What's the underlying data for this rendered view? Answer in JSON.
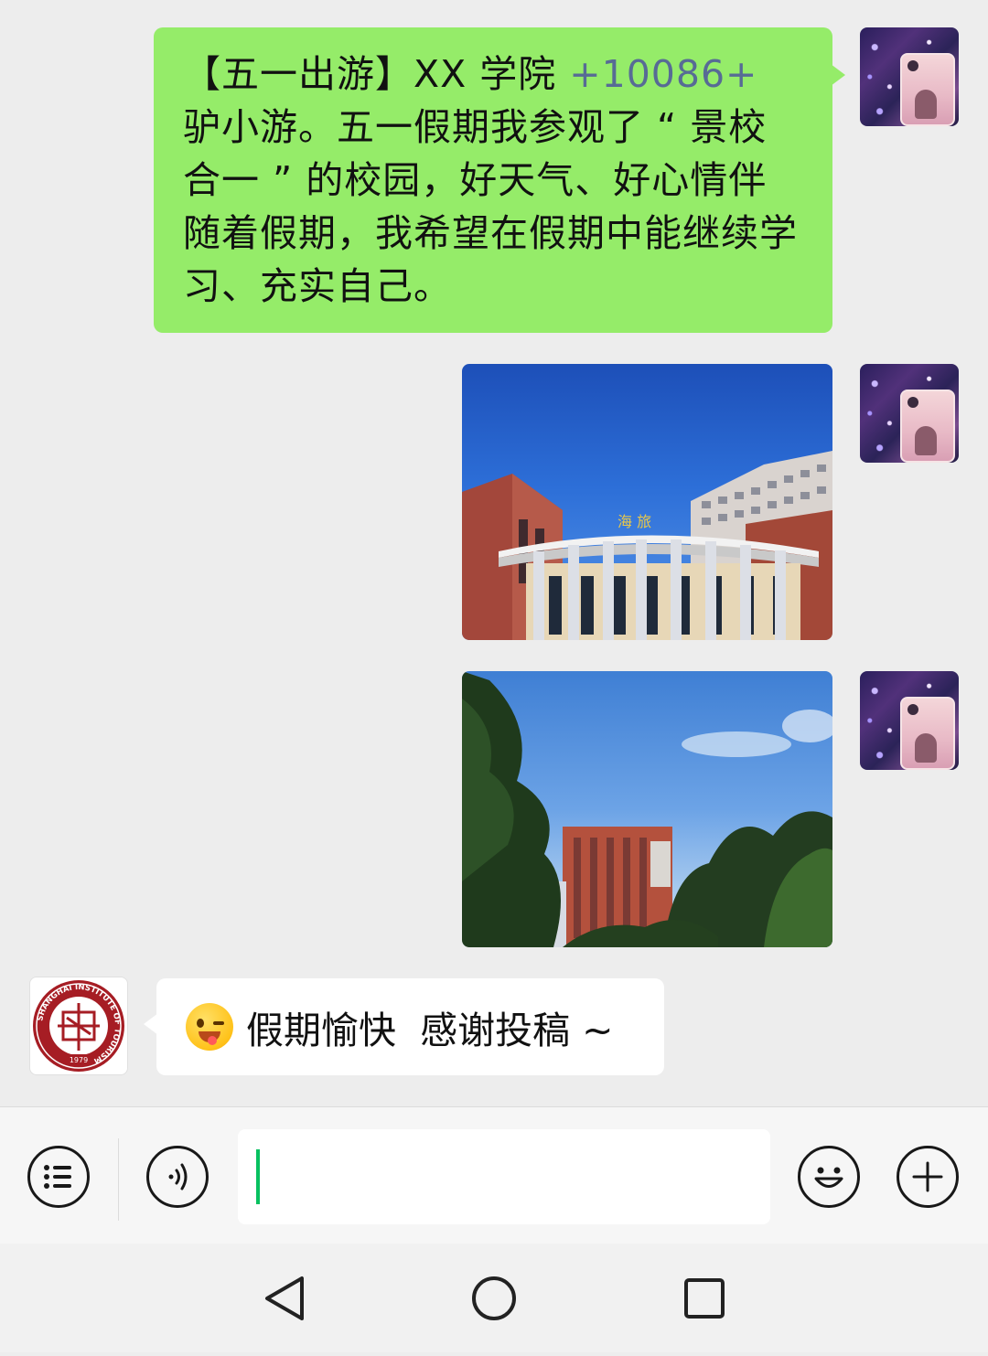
{
  "chat": {
    "messages": [
      {
        "sender": "user",
        "text_pre": "【五一出游】XX 学院 ",
        "link": "+10086+",
        "text_post": " 驴小游。五一假期我参观了 “ 景校合一 ” 的校园，好天气、好心情伴随着假期，我希望在假期中能继续学习、充实自己。"
      },
      {
        "sender": "user",
        "type": "image",
        "sign_text": "海 旅"
      },
      {
        "sender": "user",
        "type": "image"
      },
      {
        "sender": "school",
        "emoji": "wink-tongue-emoji",
        "text": "假期愉快  感谢投稿 ~"
      }
    ],
    "school_avatar": {
      "ring_text": "SHANGHAI INSTITUTE OF TOURISM",
      "year": "1979"
    }
  },
  "input_bar": {
    "list_icon": "list-menu-icon",
    "voice_icon": "voice-icon",
    "input_value": "",
    "emoji_icon": "smiley-icon",
    "plus_icon": "plus-icon"
  },
  "nav_bar": {
    "back_icon": "triangle-back-icon",
    "home_icon": "circle-home-icon",
    "recents_icon": "square-recents-icon"
  },
  "colors": {
    "chat_bg": "#ededed",
    "sent_bubble": "#95ec69",
    "received_bubble": "#ffffff",
    "link": "#576b95",
    "caret": "#07c160"
  }
}
